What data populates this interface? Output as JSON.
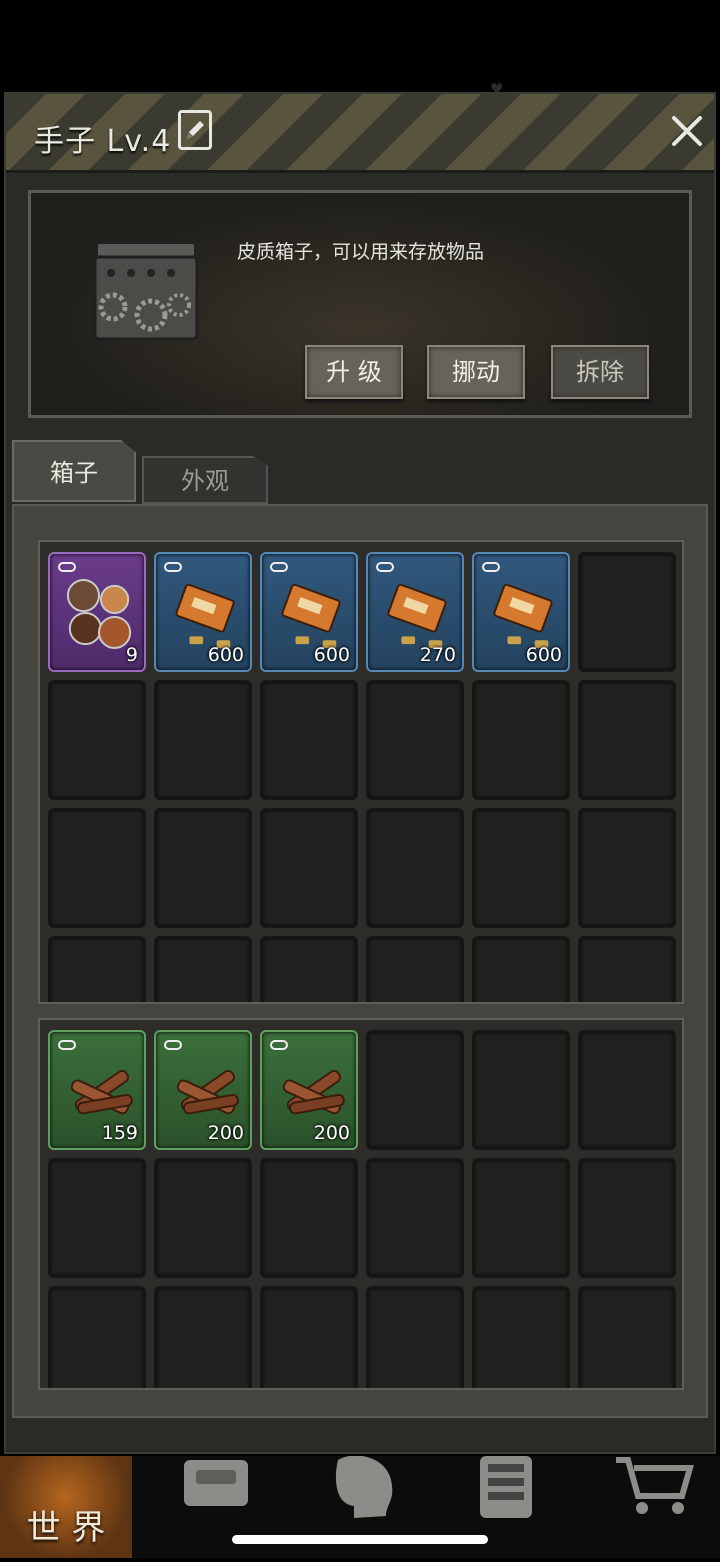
{
  "window": {
    "title": "手子 Lv.4",
    "description": "皮质箱子，可以用来存放物品",
    "buttons": {
      "upgrade": "升 级",
      "move": "挪动",
      "dismantle": "拆除"
    }
  },
  "tabs": {
    "box": "箱子",
    "appearance": "外观"
  },
  "grid_top": {
    "items": [
      {
        "rarity": "purple",
        "icon": "food-platter-icon",
        "qty": "9"
      },
      {
        "rarity": "blue",
        "icon": "ammo-box-icon",
        "qty": "600"
      },
      {
        "rarity": "blue",
        "icon": "ammo-box-icon",
        "qty": "600"
      },
      {
        "rarity": "blue",
        "icon": "ammo-box-icon",
        "qty": "270"
      },
      {
        "rarity": "blue",
        "icon": "ammo-box-icon",
        "qty": "600"
      }
    ]
  },
  "grid_bottom": {
    "items": [
      {
        "rarity": "green",
        "icon": "wood-logs-icon",
        "qty": "159"
      },
      {
        "rarity": "green",
        "icon": "wood-logs-icon",
        "qty": "200"
      },
      {
        "rarity": "green",
        "icon": "wood-logs-icon",
        "qty": "200"
      }
    ]
  },
  "nav": {
    "world": "世 界"
  },
  "colors": {
    "purple": "#6a3b8a",
    "blue": "#31587d",
    "green": "#3b6f3b"
  }
}
